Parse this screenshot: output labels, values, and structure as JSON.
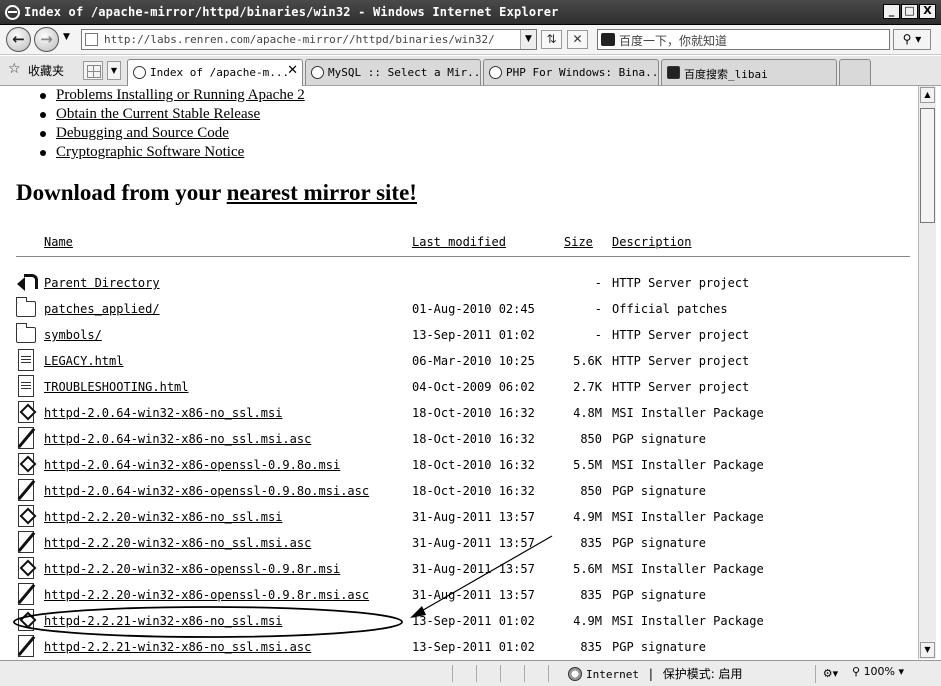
{
  "window": {
    "title": "Index of /apache-mirror/httpd/binaries/win32 - Windows Internet Explorer",
    "minimize": "_",
    "maximize": "□",
    "close": "X"
  },
  "address": {
    "url": "http://labs.renren.com/apache-mirror//httpd/binaries/win32/",
    "search_placeholder": "百度一下，你就知道"
  },
  "favorites": {
    "label": "收藏夹"
  },
  "tabs": [
    {
      "label": "Index of /apache-m...",
      "active": true,
      "icon": "ie-page-icon"
    },
    {
      "label": "MySQL :: Select a Mir...",
      "active": false,
      "icon": "ie-page-icon"
    },
    {
      "label": "PHP For Windows: Bina...",
      "active": false,
      "icon": "ie-page-icon"
    },
    {
      "label": "百度搜索_libai",
      "active": false,
      "icon": "baidu-paw-icon"
    }
  ],
  "page": {
    "links": [
      "Problems Installing or Running Apache 2",
      "Obtain the Current Stable Release",
      "Debugging and Source Code",
      "Cryptographic Software Notice"
    ],
    "mirror_heading_prefix": "Download from your ",
    "mirror_heading_link": "nearest mirror site!",
    "columns": {
      "name": "Name",
      "modified": "Last modified",
      "size": "Size",
      "desc": "Description"
    },
    "rows": [
      {
        "icon": "back",
        "name": "Parent Directory",
        "modified": "",
        "size": "-",
        "desc": "HTTP Server project"
      },
      {
        "icon": "folder",
        "name": "patches_applied/",
        "modified": "01-Aug-2010 02:45",
        "size": "-",
        "desc": "Official patches"
      },
      {
        "icon": "folder",
        "name": "symbols/",
        "modified": "13-Sep-2011 01:02",
        "size": "-",
        "desc": "HTTP Server project"
      },
      {
        "icon": "doc",
        "name": "LEGACY.html",
        "modified": "06-Mar-2010 10:25",
        "size": "5.6K",
        "desc": "HTTP Server project"
      },
      {
        "icon": "doc",
        "name": "TROUBLESHOOTING.html",
        "modified": "04-Oct-2009 06:02",
        "size": "2.7K",
        "desc": "HTTP Server project"
      },
      {
        "icon": "pkg",
        "name": "httpd-2.0.64-win32-x86-no_ssl.msi",
        "modified": "18-Oct-2010 16:32",
        "size": "4.8M",
        "desc": "MSI Installer Package"
      },
      {
        "icon": "sig",
        "name": "httpd-2.0.64-win32-x86-no_ssl.msi.asc",
        "modified": "18-Oct-2010 16:32",
        "size": "850",
        "desc": "PGP signature"
      },
      {
        "icon": "pkg",
        "name": "httpd-2.0.64-win32-x86-openssl-0.9.8o.msi",
        "modified": "18-Oct-2010 16:32",
        "size": "5.5M",
        "desc": "MSI Installer Package"
      },
      {
        "icon": "sig",
        "name": "httpd-2.0.64-win32-x86-openssl-0.9.8o.msi.asc",
        "modified": "18-Oct-2010 16:32",
        "size": "850",
        "desc": "PGP signature"
      },
      {
        "icon": "pkg",
        "name": "httpd-2.2.20-win32-x86-no_ssl.msi",
        "modified": "31-Aug-2011 13:57",
        "size": "4.9M",
        "desc": "MSI Installer Package"
      },
      {
        "icon": "sig",
        "name": "httpd-2.2.20-win32-x86-no_ssl.msi.asc",
        "modified": "31-Aug-2011 13:57",
        "size": "835",
        "desc": "PGP signature"
      },
      {
        "icon": "pkg",
        "name": "httpd-2.2.20-win32-x86-openssl-0.9.8r.msi",
        "modified": "31-Aug-2011 13:57",
        "size": "5.6M",
        "desc": "MSI Installer Package"
      },
      {
        "icon": "sig",
        "name": "httpd-2.2.20-win32-x86-openssl-0.9.8r.msi.asc",
        "modified": "31-Aug-2011 13:57",
        "size": "835",
        "desc": "PGP signature"
      },
      {
        "icon": "pkg",
        "name": "httpd-2.2.21-win32-x86-no_ssl.msi",
        "modified": "13-Sep-2011 01:02",
        "size": "4.9M",
        "desc": "MSI Installer Package",
        "highlighted": true
      },
      {
        "icon": "sig",
        "name": "httpd-2.2.21-win32-x86-no_ssl.msi.asc",
        "modified": "13-Sep-2011 01:02",
        "size": "835",
        "desc": "PGP signature"
      }
    ]
  },
  "status": {
    "zone": "Internet",
    "separator": "|",
    "protected_mode": "保护模式: 启用",
    "zoom": "100%"
  }
}
